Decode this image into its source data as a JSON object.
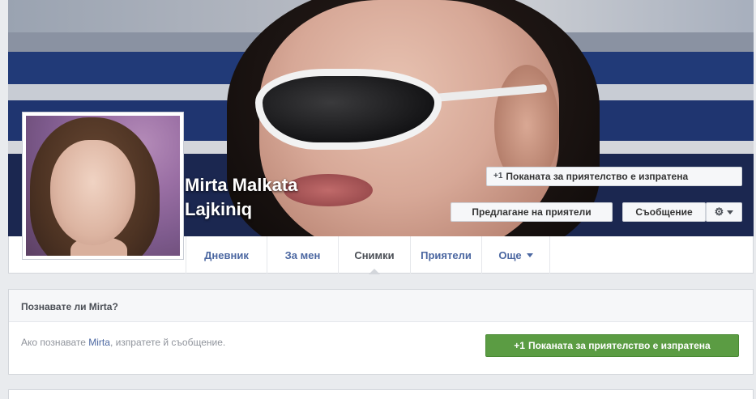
{
  "profile": {
    "name_line1": "Mirta Malkata",
    "name_line2": "Lajkiniq"
  },
  "cover_buttons": {
    "friend_request_label": "Поканата за приятелство е изпратена",
    "suggest_friends_label": "Предлагане на приятели",
    "message_label": "Съобщение"
  },
  "tabs": [
    {
      "label": "Дневник"
    },
    {
      "label": "За мен"
    },
    {
      "label": "Снимки"
    },
    {
      "label": "Приятели"
    },
    {
      "label": "Още"
    }
  ],
  "know_box": {
    "title": "Познавате ли Mirta?",
    "text_prefix": "Ако познавате ",
    "text_link": "Mirta",
    "text_suffix": ", изпратете й съобщение.",
    "button_label": "Поканата за приятелство е изпратена"
  },
  "icons": {
    "plus": "+1",
    "gear": "⚙"
  },
  "colors": {
    "link": "#4b67a1",
    "green_button": "#5b9c43",
    "page_bg": "#e9ebee"
  }
}
